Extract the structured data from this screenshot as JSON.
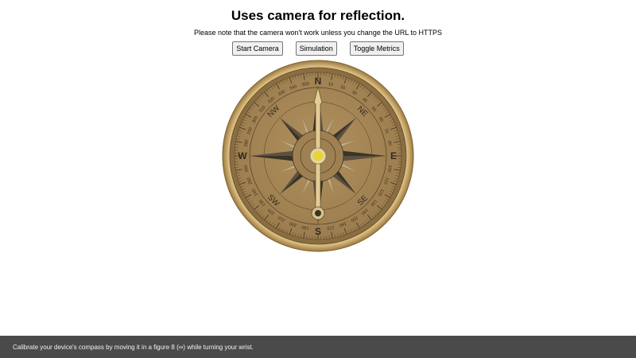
{
  "header": {
    "title": "Uses camera for reflection.",
    "notice": "Please note that the camera won't work unless you change the URL to HTTPS"
  },
  "toolbar": {
    "start_camera_label": "Start Camera",
    "simulation_label": "Simulation",
    "toggle_metrics_label": "Toggle Metrics"
  },
  "compass": {
    "cardinals": {
      "n": "N",
      "e": "E",
      "s": "S",
      "w": "W"
    },
    "intercardinals": {
      "ne": "NE",
      "se": "SE",
      "sw": "SW",
      "nw": "NW"
    },
    "degree_labels": [
      "0",
      "10",
      "20",
      "30",
      "40",
      "50",
      "60",
      "70",
      "80",
      "90",
      "100",
      "110",
      "120",
      "130",
      "140",
      "150",
      "160",
      "170",
      "180",
      "190",
      "200",
      "210",
      "220",
      "230",
      "240",
      "250",
      "260",
      "270",
      "280",
      "290",
      "300",
      "310",
      "320",
      "330",
      "340",
      "350"
    ],
    "heading_degrees": 0,
    "colors": {
      "case": "#c9a463",
      "bezel": "#8e7141",
      "face": "#a88857",
      "rose_dark": "#3a3428",
      "rose_light": "#c7b58d",
      "needle": "#e6d19a",
      "pivot": "#e8d437"
    }
  },
  "footer": {
    "calibration_text": "Calibrate your device's compass by moving it in a figure 8 (∞) while turning your wrist."
  }
}
